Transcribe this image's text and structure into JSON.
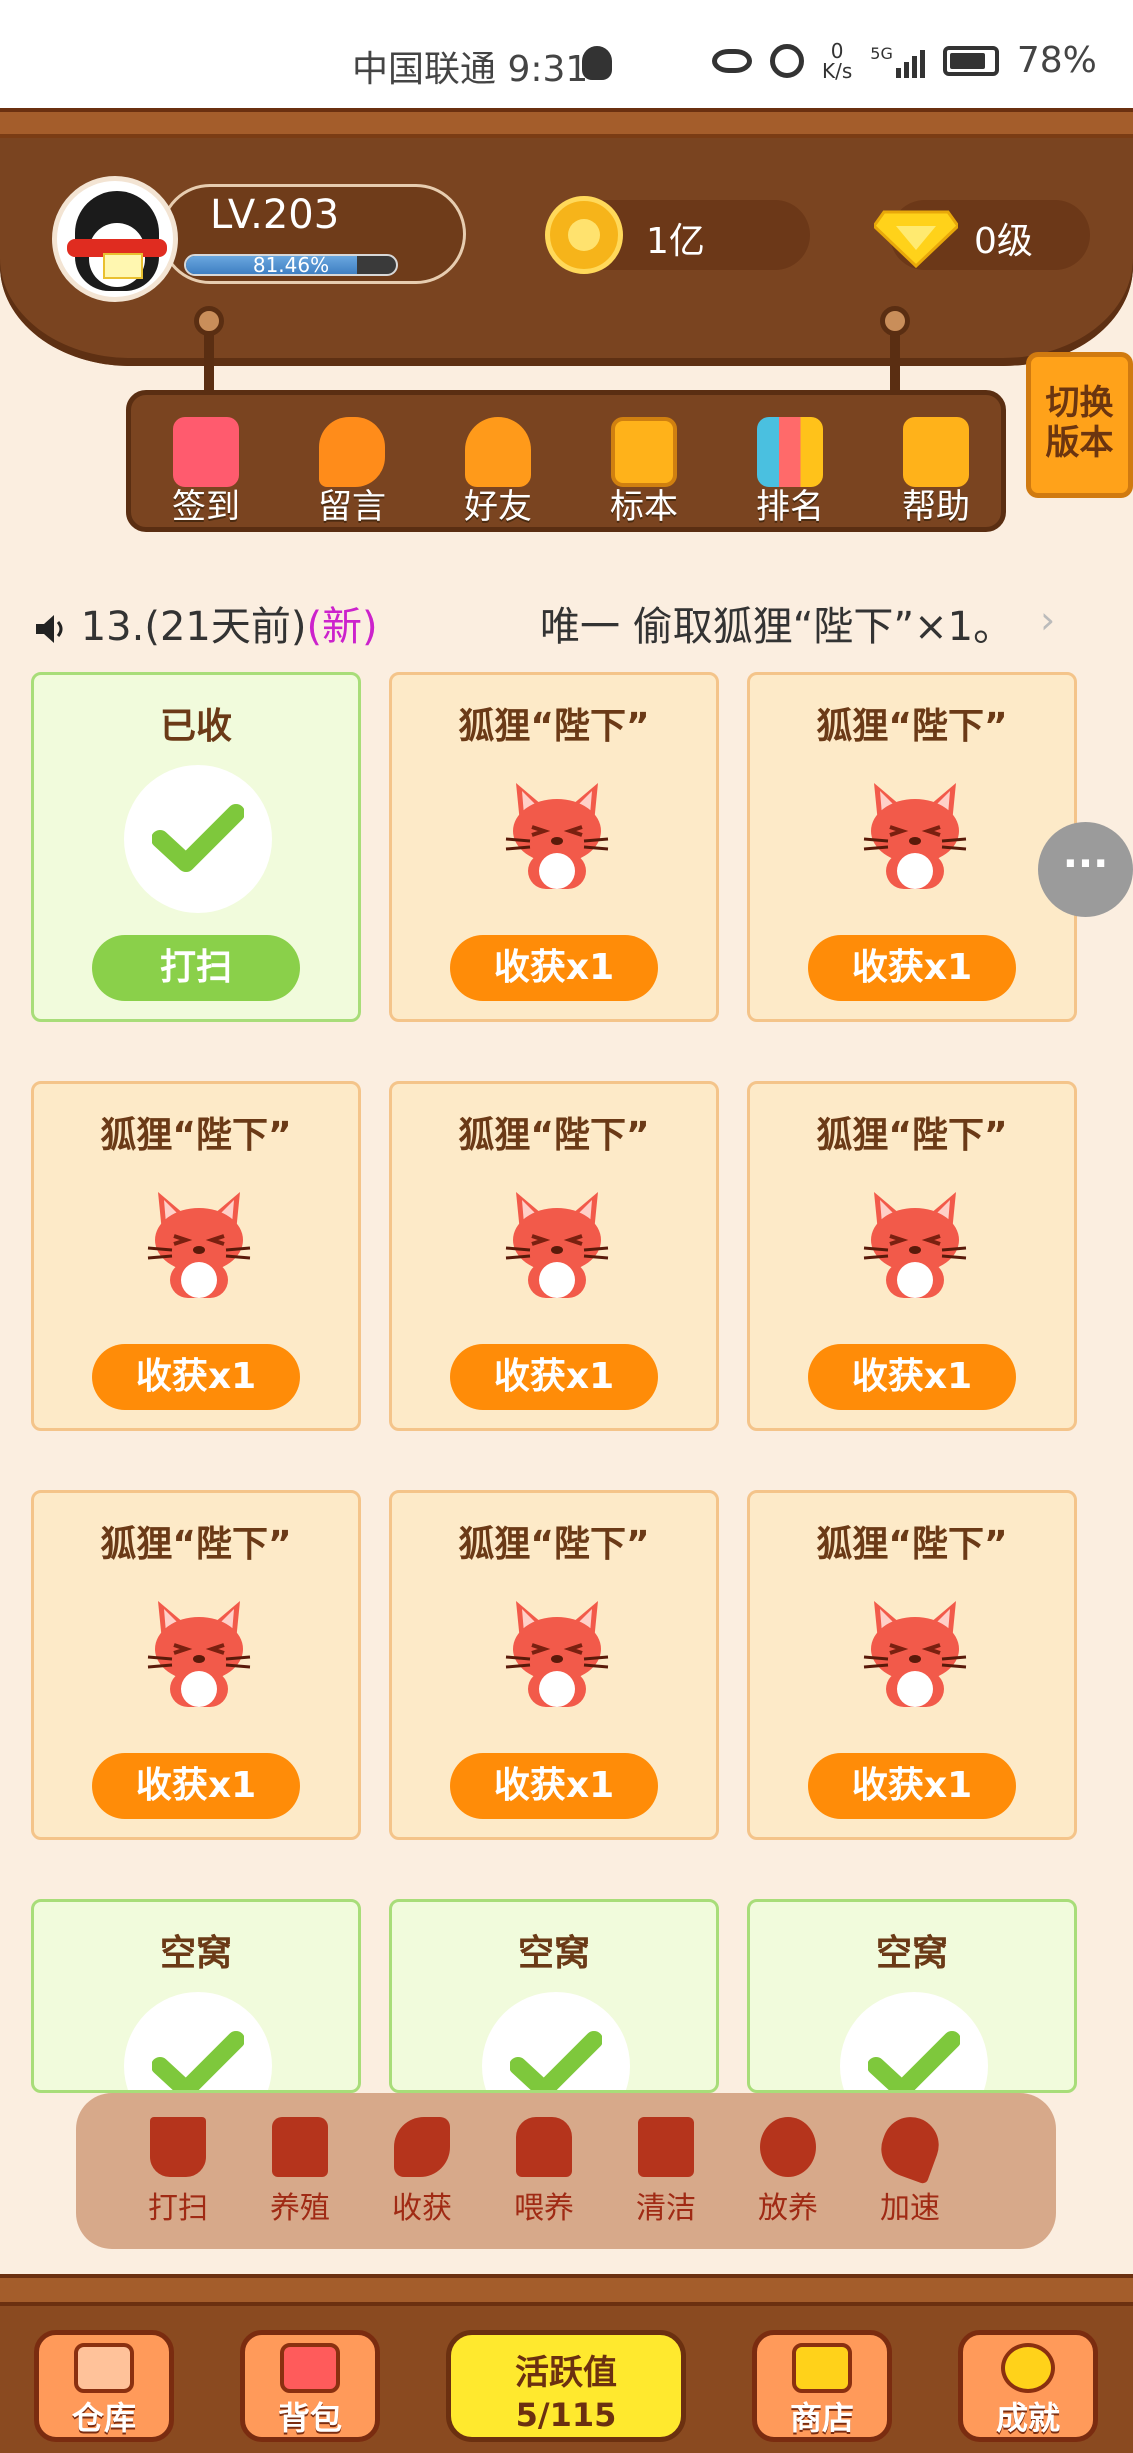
{
  "status_bar": {
    "carrier_time": "中国联通 9:31",
    "speed_top": "0",
    "speed_bottom": "K/s",
    "network": "5G",
    "battery": "78%"
  },
  "player": {
    "level": "LV.203",
    "exp_text": "81.46%",
    "exp_progress": 0.8146,
    "coins": "1亿",
    "gem_level": "0级"
  },
  "toolbar": {
    "items": [
      {
        "label": "签到",
        "icon": "calendar-icon",
        "color": "#ff5b6e"
      },
      {
        "label": "留言",
        "icon": "chat-icon",
        "color": "#ff8c1a"
      },
      {
        "label": "好友",
        "icon": "friend-icon",
        "color": "#ff9a1a"
      },
      {
        "label": "标本",
        "icon": "specimen-book-icon",
        "color": "#ffb21a"
      },
      {
        "label": "排名",
        "icon": "ranking-icon",
        "color": "#ff6a6a"
      },
      {
        "label": "帮助",
        "icon": "help-icon",
        "color": "#ffb21a"
      }
    ],
    "switch_label_1": "切换",
    "switch_label_2": "版本"
  },
  "notice": {
    "prefix": "13.(21天前)",
    "new_tag": "(新)",
    "message": "唯一    偷取狐狸“陛下”×1。"
  },
  "slots": [
    {
      "title": "已收",
      "type": "done",
      "button": "打扫"
    },
    {
      "title": "狐狸“陛下”",
      "type": "fox",
      "button": "收获x1"
    },
    {
      "title": "狐狸“陛下”",
      "type": "fox",
      "button": "收获x1"
    },
    {
      "title": "狐狸“陛下”",
      "type": "fox",
      "button": "收获x1"
    },
    {
      "title": "狐狸“陛下”",
      "type": "fox",
      "button": "收获x1"
    },
    {
      "title": "狐狸“陛下”",
      "type": "fox",
      "button": "收获x1"
    },
    {
      "title": "狐狸“陛下”",
      "type": "fox",
      "button": "收获x1"
    },
    {
      "title": "狐狸“陛下”",
      "type": "fox",
      "button": "收获x1"
    },
    {
      "title": "狐狸“陛下”",
      "type": "fox",
      "button": "收获x1"
    },
    {
      "title": "空窝",
      "type": "empty",
      "button": ""
    },
    {
      "title": "空窝",
      "type": "empty",
      "button": ""
    },
    {
      "title": "空窝",
      "type": "empty",
      "button": ""
    }
  ],
  "more_button": "···",
  "action_bar": {
    "items": [
      {
        "label": "打扫",
        "icon": "broom-icon"
      },
      {
        "label": "养殖",
        "icon": "breed-icon"
      },
      {
        "label": "收获",
        "icon": "harvest-icon"
      },
      {
        "label": "喂养",
        "icon": "feed-icon"
      },
      {
        "label": "清洁",
        "icon": "spray-clean-icon"
      },
      {
        "label": "放养",
        "icon": "paw-icon"
      },
      {
        "label": "加速",
        "icon": "rocket-icon"
      }
    ]
  },
  "bottom_nav": {
    "warehouse": "仓库",
    "backpack": "背包",
    "activity_label": "活跃值",
    "activity_value": "5/115",
    "shop": "商店",
    "achievement": "成就"
  }
}
